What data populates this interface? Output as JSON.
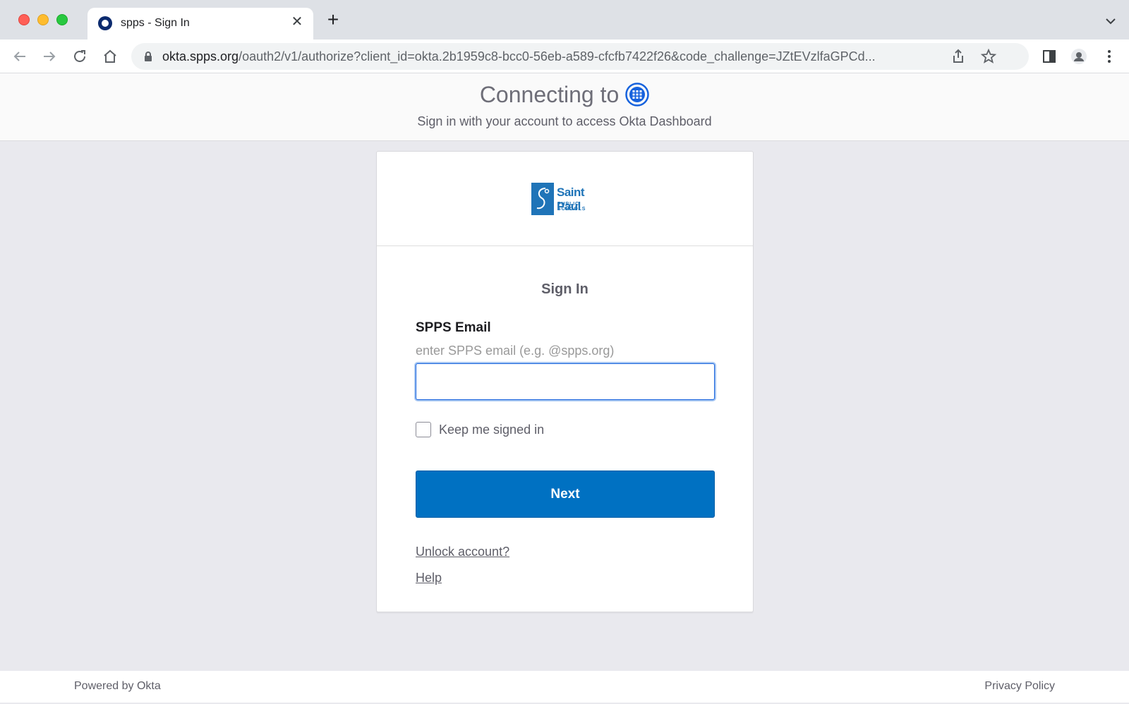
{
  "browser": {
    "tab_title": "spps - Sign In",
    "url_host": "okta.spps.org",
    "url_rest": "/oauth2/v1/authorize?client_id=okta.2b1959c8-bcc0-56eb-a589-cfcfb7422f26&code_challenge=JZtEVzlfaGPCd..."
  },
  "connect": {
    "title": "Connecting to",
    "subtitle": "Sign in with your account to access Okta Dashboard"
  },
  "logo": {
    "name": "Saint Paul",
    "sub": "PUBLIC SCHOOLS"
  },
  "form": {
    "title": "Sign In",
    "email_label": "SPPS Email",
    "email_hint": "enter SPPS email (e.g. @spps.org)",
    "email_value": "",
    "keep_signed_in_label": "Keep me signed in",
    "keep_signed_in_checked": false,
    "next_label": "Next",
    "unlock_link": "Unlock account?",
    "help_link": "Help"
  },
  "footer": {
    "powered_by": "Powered by Okta",
    "privacy": "Privacy Policy"
  },
  "colors": {
    "primary_button": "#0071c2",
    "brand_blue": "#1f74b8",
    "page_bg": "#e9e9ee"
  }
}
